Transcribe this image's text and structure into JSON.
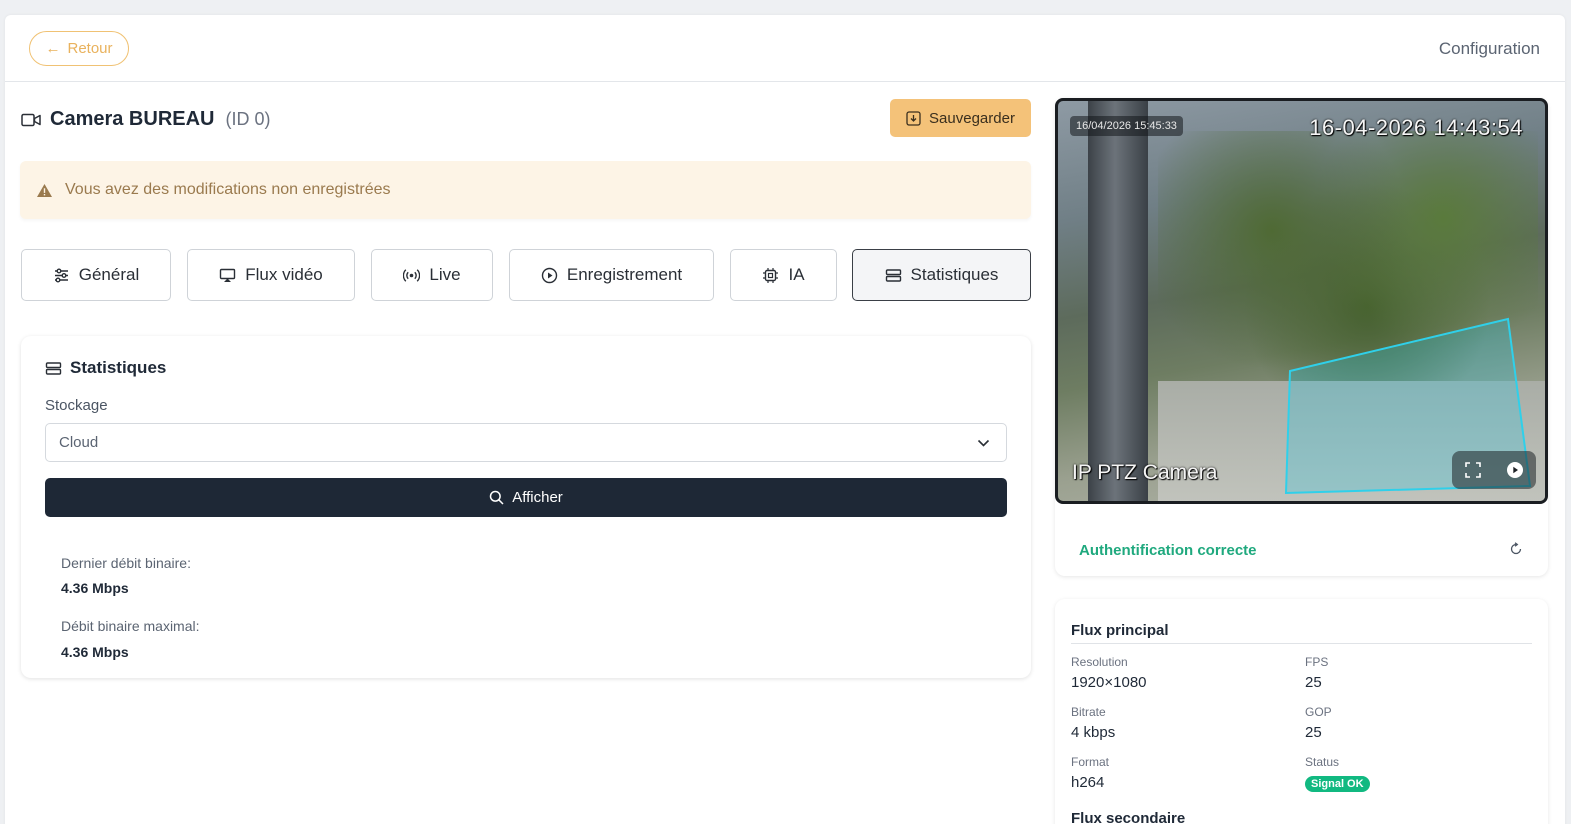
{
  "topbar": {
    "back_label": "Retour",
    "page_title": "Configuration"
  },
  "camera": {
    "name": "Camera BUREAU",
    "id_label": "(ID 0)"
  },
  "actions": {
    "save_label": "Sauvegarder"
  },
  "alert": {
    "message": "Vous avez des modifications non enregistrées"
  },
  "tabs": [
    {
      "label": "Général",
      "icon": "sliders-icon"
    },
    {
      "label": "Flux vidéo",
      "icon": "monitor-icon"
    },
    {
      "label": "Live",
      "icon": "broadcast-icon"
    },
    {
      "label": "Enregistrement",
      "icon": "play-circle-icon"
    },
    {
      "label": "IA",
      "icon": "chip-icon"
    },
    {
      "label": "Statistiques",
      "icon": "server-icon",
      "active": true
    }
  ],
  "stats": {
    "title": "Statistiques",
    "storage_label": "Stockage",
    "storage_selected": "Cloud",
    "show_button": "Afficher",
    "last_bitrate_label": "Dernier débit binaire:",
    "last_bitrate_value": "4.36 Mbps",
    "max_bitrate_label": "Débit binaire maximal:",
    "max_bitrate_value": "4.36 Mbps"
  },
  "preview": {
    "timestamp_small": "16/04/2026 15:45:33",
    "timestamp_overlay": "16-04-2026 14:43:54",
    "camera_label": "IP PTZ Camera",
    "auth_status": "Authentification correcte"
  },
  "flux_principal": {
    "title": "Flux principal",
    "resolution_label": "Resolution",
    "resolution_value": "1920×1080",
    "fps_label": "FPS",
    "fps_value": "25",
    "bitrate_label": "Bitrate",
    "bitrate_value": "4 kbps",
    "gop_label": "GOP",
    "gop_value": "25",
    "format_label": "Format",
    "format_value": "h264",
    "status_label": "Status",
    "status_value": "Signal OK"
  },
  "flux_secondaire": {
    "title": "Flux secondaire"
  },
  "colors": {
    "accent": "#f4c279",
    "dark_button": "#1e2836",
    "success": "#11b981",
    "alert_bg": "#fdf4e6"
  }
}
